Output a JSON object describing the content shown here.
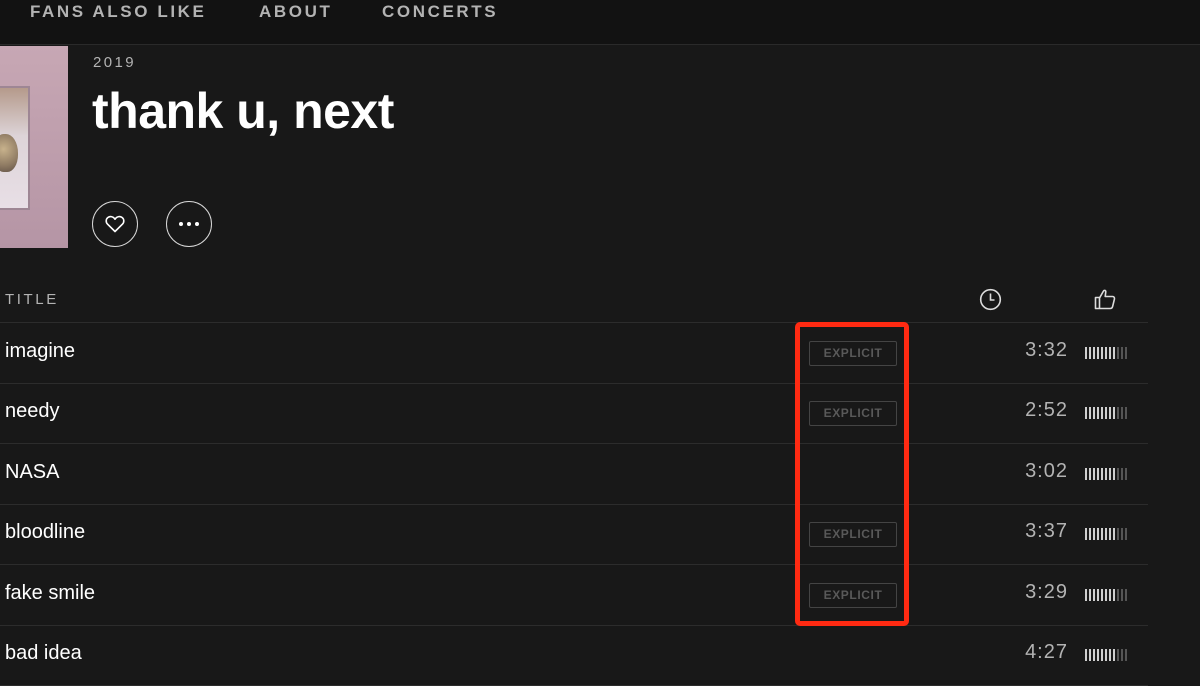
{
  "nav": {
    "tabs": [
      "FANS ALSO LIKE",
      "ABOUT",
      "CONCERTS"
    ]
  },
  "album": {
    "year": "2019",
    "title": "thank u, next"
  },
  "actions": {
    "like_icon": "heart-icon",
    "more_icon": "more-options-icon"
  },
  "tracklist": {
    "header_title": "TITLE",
    "duration_icon": "clock-icon",
    "popularity_icon": "thumbs-up-icon",
    "explicit_label": "EXPLICIT",
    "tracks": [
      {
        "name": "imagine",
        "explicit": true,
        "duration": "3:32",
        "popularity": 0.7
      },
      {
        "name": "needy",
        "explicit": true,
        "duration": "2:52",
        "popularity": 0.7
      },
      {
        "name": "NASA",
        "explicit": false,
        "duration": "3:02",
        "popularity": 0.7
      },
      {
        "name": "bloodline",
        "explicit": true,
        "duration": "3:37",
        "popularity": 0.7
      },
      {
        "name": "fake smile",
        "explicit": true,
        "duration": "3:29",
        "popularity": 0.7
      },
      {
        "name": "bad idea",
        "explicit": false,
        "duration": "4:27",
        "popularity": 0.7
      }
    ]
  },
  "colors": {
    "background": "#181818",
    "highlight": "#ff2a12"
  }
}
